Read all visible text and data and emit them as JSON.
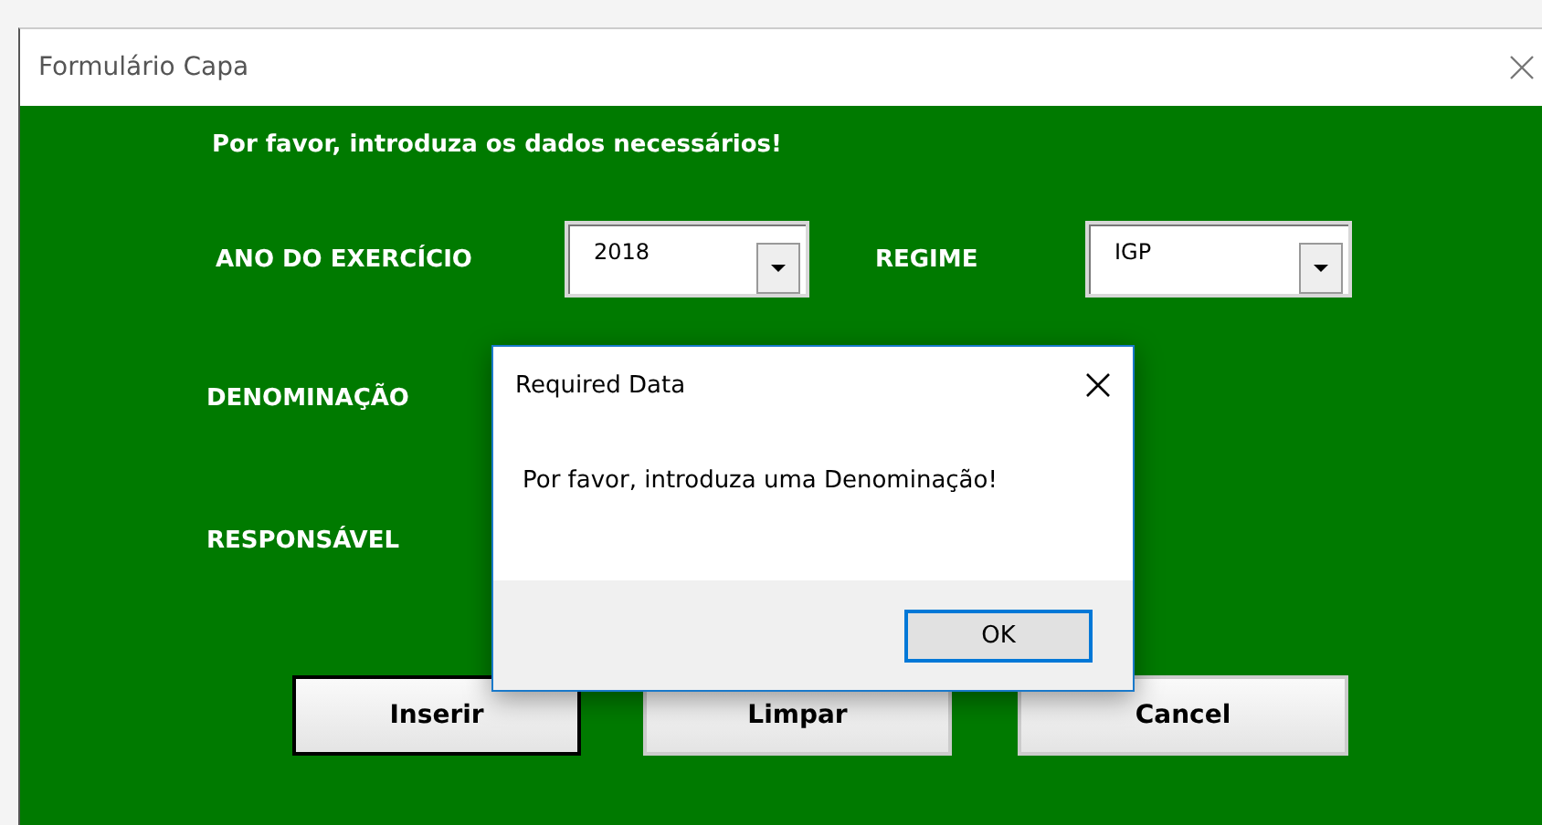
{
  "window": {
    "title": "Formulário Capa"
  },
  "form": {
    "heading": "Por favor, introduza os dados necessários!",
    "year": {
      "label": "ANO DO EXERCÍCIO",
      "value": "2018"
    },
    "regime": {
      "label": "REGIME",
      "value": "IGP"
    },
    "labels": [
      "DENOMINAÇÃO",
      "RESPONSÁVEL"
    ],
    "buttons": [
      {
        "label": "Inserir",
        "default": true
      },
      {
        "label": "Limpar",
        "default": false
      },
      {
        "label": "Cancel",
        "default": false
      }
    ]
  },
  "dialog": {
    "title": "Required Data",
    "message": "Por favor, introduza uma Denominação!",
    "button": "OK"
  }
}
